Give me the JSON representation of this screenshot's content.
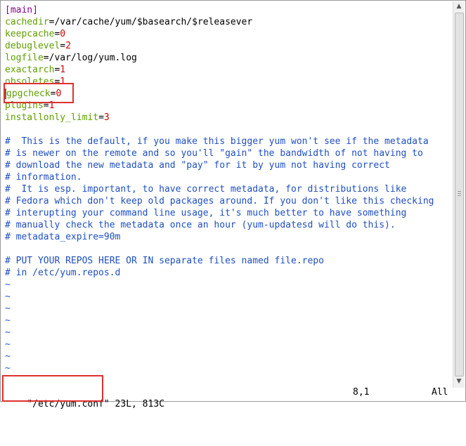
{
  "editor": {
    "lines": [
      {
        "type": "section",
        "text": "[main]"
      },
      {
        "type": "kv",
        "key": "cachedir",
        "value": "/var/cache/yum/$basearch/$releasever"
      },
      {
        "type": "kv",
        "key": "keepcache",
        "value": "0"
      },
      {
        "type": "kv",
        "key": "debuglevel",
        "value": "2"
      },
      {
        "type": "kv",
        "key": "logfile",
        "value": "/var/log/yum.log"
      },
      {
        "type": "kv",
        "key": "exactarch",
        "value": "1"
      },
      {
        "type": "kv",
        "key": "obsoletes",
        "value": "1"
      },
      {
        "type": "kv",
        "key": "gpgcheck",
        "value": "0",
        "cursor": true
      },
      {
        "type": "kv",
        "key": "plugins",
        "value": "1"
      },
      {
        "type": "kv",
        "key": "installonly_limit",
        "value": "3"
      },
      {
        "type": "blank",
        "text": ""
      },
      {
        "type": "comment",
        "text": "#  This is the default, if you make this bigger yum won't see if the metadata"
      },
      {
        "type": "comment",
        "text": "# is newer on the remote and so you'll \"gain\" the bandwidth of not having to"
      },
      {
        "type": "comment",
        "text": "# download the new metadata and \"pay\" for it by yum not having correct"
      },
      {
        "type": "comment",
        "text": "# information."
      },
      {
        "type": "comment",
        "text": "#  It is esp. important, to have correct metadata, for distributions like"
      },
      {
        "type": "comment",
        "text": "# Fedora which don't keep old packages around. If you don't like this checking"
      },
      {
        "type": "comment",
        "text": "# interupting your command line usage, it's much better to have something"
      },
      {
        "type": "comment",
        "text": "# manually check the metadata once an hour (yum-updatesd will do this)."
      },
      {
        "type": "comment",
        "text": "# metadata_expire=90m"
      },
      {
        "type": "blank",
        "text": ""
      },
      {
        "type": "comment",
        "text": "# PUT YOUR REPOS HERE OR IN separate files named file.repo"
      },
      {
        "type": "comment",
        "text": "# in /etc/yum.repos.d"
      },
      {
        "type": "tilde",
        "text": "~"
      },
      {
        "type": "tilde",
        "text": "~"
      },
      {
        "type": "tilde",
        "text": "~"
      },
      {
        "type": "tilde",
        "text": "~"
      },
      {
        "type": "tilde",
        "text": "~"
      },
      {
        "type": "tilde",
        "text": "~"
      },
      {
        "type": "tilde",
        "text": "~"
      },
      {
        "type": "tilde",
        "text": "~"
      }
    ]
  },
  "status": {
    "file_info": "\"/etc/yum.conf\" 23L, 813C",
    "position": "8,1",
    "percent": "All"
  },
  "colors": {
    "key": "#5f9f00",
    "value": "#d00000",
    "comment": "#1f4fbf",
    "section": "#8a008a",
    "tilde": "#2e56c9",
    "highlight_box": "#e03030"
  }
}
